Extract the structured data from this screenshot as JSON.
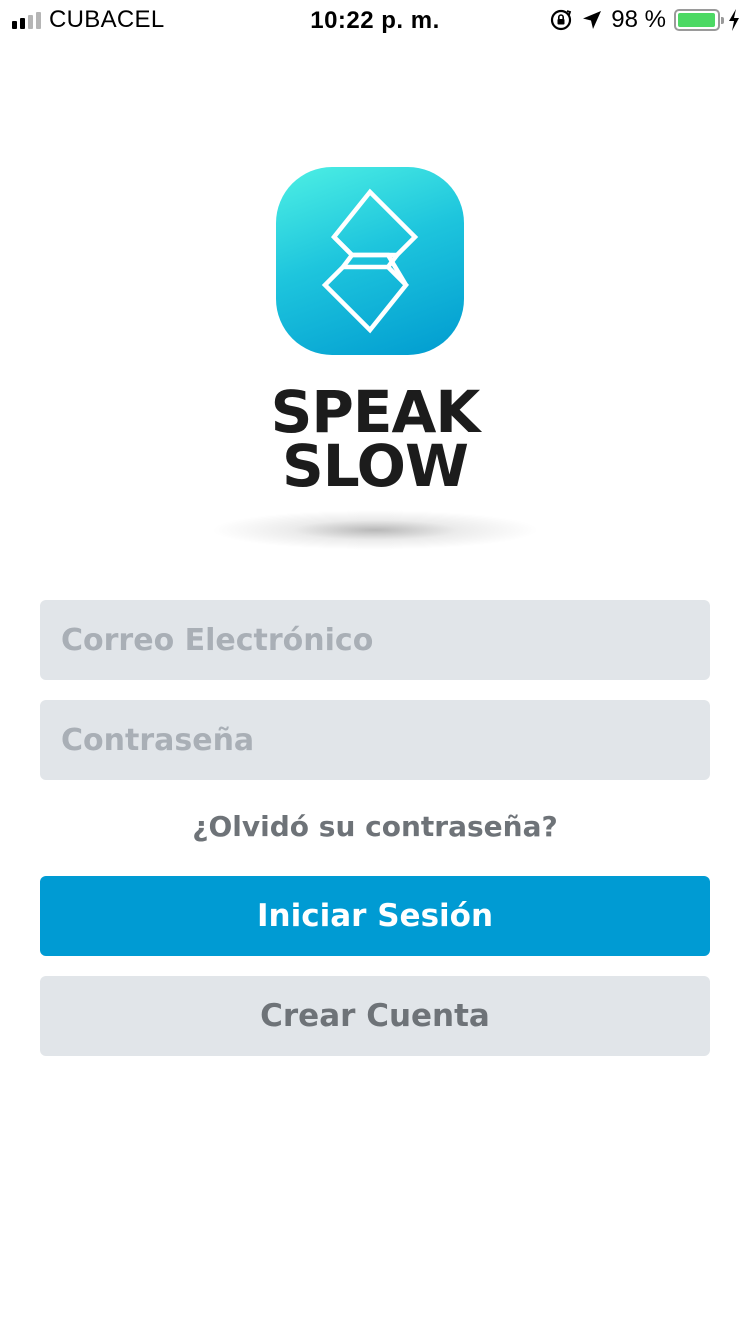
{
  "status_bar": {
    "carrier": "CUBACEL",
    "time": "10:22 p. m.",
    "battery_percent": "98 %",
    "battery_level": 0.98,
    "icons": [
      "signal-icon",
      "orientation-lock-icon",
      "location-arrow-icon",
      "battery-icon",
      "charging-bolt-icon"
    ]
  },
  "logo": {
    "line1": "SPEAK",
    "line2": "SLOW",
    "colors": {
      "gradient_start": "#4ef0e4",
      "gradient_end": "#009bd0"
    }
  },
  "login_form": {
    "email_placeholder": "Correo Electrónico",
    "password_placeholder": "Contraseña",
    "forgot_password": "¿Olvidó su contraseña?",
    "login_button": "Iniciar Sesión",
    "create_account_button": "Crear Cuenta"
  },
  "colors": {
    "primary": "#009bd3",
    "field_bg": "#e1e5e9",
    "secondary_text": "#6e7378",
    "battery_green": "#4cd964"
  }
}
